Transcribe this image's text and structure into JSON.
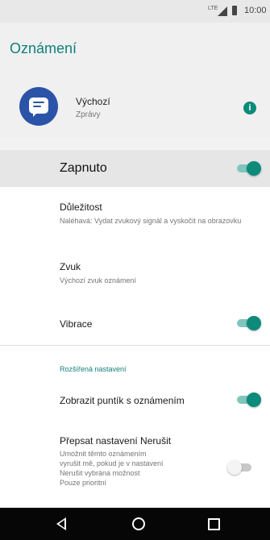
{
  "status_bar": {
    "network": "LTE",
    "time": "10:00"
  },
  "app_bar": {
    "title": "Oznámení"
  },
  "app_info": {
    "name": "Výchozí",
    "subtitle": "Zprávy",
    "icon": "messages-icon",
    "info_icon": "info-icon"
  },
  "master_switch": {
    "label": "Zapnuto",
    "on": true
  },
  "settings": {
    "importance": {
      "title": "Důležitost",
      "summary": "Naléhavá: Vydat zvukový signál a vyskočit na obrazovku"
    },
    "sound": {
      "title": "Zvuk",
      "summary": "Výchozí zvuk oznámení"
    },
    "vibration": {
      "title": "Vibrace",
      "on": true
    }
  },
  "advanced": {
    "header": "Rozšířená nastavení",
    "notification_dot": {
      "title": "Zobrazit puntík s oznámením",
      "on": true
    },
    "dnd_override": {
      "title": "Přepsat nastavení Nerušit",
      "summary_lines": [
        "Umožnit těmto oznámením",
        "vyrušit mě, pokud je v nastavení",
        "Nerušit vybrána možnost",
        "Pouze prioritní"
      ],
      "on": false
    }
  },
  "colors": {
    "accent": "#0f7f79",
    "toggle_on": "#0e8a7a",
    "app_icon_bg": "#2b54a8"
  },
  "nav_bar": {
    "icons": [
      "back-icon",
      "home-icon",
      "recents-icon"
    ]
  }
}
